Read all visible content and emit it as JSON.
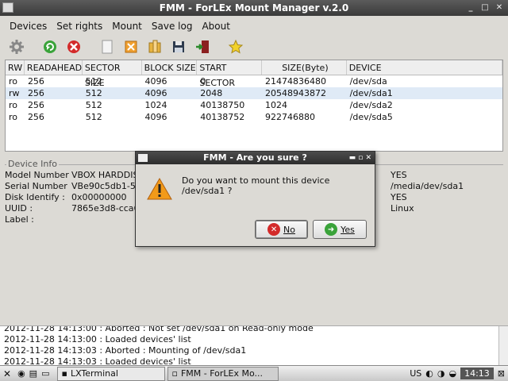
{
  "window": {
    "title": "FMM - ForLEx Mount Manager v.2.0"
  },
  "menu": [
    "Devices",
    "Set rights",
    "Mount",
    "Save log",
    "About"
  ],
  "table": {
    "headers": [
      "RW",
      "READAHEAD",
      "SECTOR SIZE",
      "BLOCK SIZE",
      "START SECTOR",
      "SIZE(Byte)",
      "DEVICE"
    ],
    "rows": [
      [
        "ro",
        "256",
        "512",
        "4096",
        "0",
        "21474836480",
        "/dev/sda"
      ],
      [
        "rw",
        "256",
        "512",
        "4096",
        "2048",
        "20548943872",
        "/dev/sda1"
      ],
      [
        "ro",
        "256",
        "512",
        "1024",
        "40138750",
        "1024",
        "/dev/sda2"
      ],
      [
        "ro",
        "256",
        "512",
        "4096",
        "40138752",
        "922746880",
        "/dev/sda5"
      ]
    ]
  },
  "device_info": {
    "legend": "Device Info",
    "fields": [
      {
        "key": "Model Number :",
        "value": "VBOX HARDDIS",
        "right": "YES"
      },
      {
        "key": "Serial Number :",
        "value": "VBe90c5db1-57",
        "right": "/media/dev/sda1"
      },
      {
        "key": "Disk Identify :",
        "value": "0x00000000",
        "right": "YES"
      },
      {
        "key": "UUID :",
        "value": "7865e3d8-cca6",
        "right": "Linux"
      },
      {
        "key": "Label :",
        "value": "",
        "right": ""
      }
    ]
  },
  "log": [
    "2012-11-28 14:13:00 : Aborted : Not set /dev/sda1 on Read-only mode",
    "2012-11-28 14:13:00 : Loaded devices' list",
    "2012-11-28 14:13:03 : Aborted : Mounting of /dev/sda1",
    "2012-11-28 14:13:03 : Loaded devices' list"
  ],
  "dialog": {
    "title": "FMM - Are you sure ?",
    "message": "Do you want to mount this device /dev/sda1 ?",
    "no_label": "No",
    "yes_label": "Yes"
  },
  "taskbar": {
    "items": [
      "LXTerminal",
      "FMM - ForLEx Mo..."
    ],
    "lang": "US",
    "clock": "14:13"
  }
}
